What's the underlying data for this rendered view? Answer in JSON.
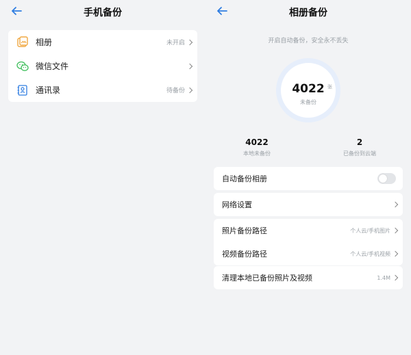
{
  "left": {
    "title": "手机备份",
    "items": [
      {
        "label": "相册",
        "value": "未开启",
        "icon": "photo-album-icon"
      },
      {
        "label": "微信文件",
        "value": "",
        "icon": "wechat-icon"
      },
      {
        "label": "通讯录",
        "value": "待备份",
        "icon": "contacts-icon"
      }
    ]
  },
  "right": {
    "title": "相册备份",
    "subtitle": "开启自动备份，安全永不丢失",
    "ring": {
      "count": "4022",
      "unit": "张",
      "caption": "未备份"
    },
    "stats": [
      {
        "num": "4022",
        "caption": "本地未备份"
      },
      {
        "num": "2",
        "caption": "已备份到云端"
      }
    ],
    "auto_backup": {
      "label": "自动备份相册",
      "enabled": false
    },
    "network": {
      "label": "网络设置"
    },
    "photo_path": {
      "label": "照片备份路径",
      "value": "个人云/手机图片"
    },
    "video_path": {
      "label": "视频备份路径",
      "value": "个人云/手机视频"
    },
    "clean": {
      "label": "清理本地已备份照片及视频",
      "value": "1.4M"
    }
  },
  "colors": {
    "accent": "#2f7de1",
    "background": "#f2f3f5",
    "ring": "#e6eefb"
  }
}
